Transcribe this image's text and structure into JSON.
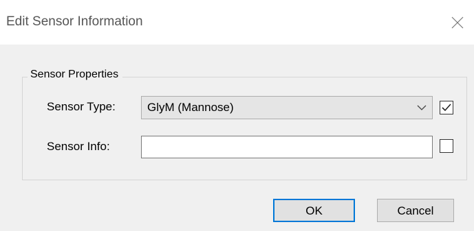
{
  "window": {
    "title": "Edit Sensor Information",
    "close_icon": "close-icon"
  },
  "group": {
    "legend": "Sensor Properties"
  },
  "sensor_type": {
    "label": "Sensor Type:",
    "selected_value": "GlyM (Mannose)",
    "checkbox_checked": true
  },
  "sensor_info": {
    "label": "Sensor Info:",
    "value": "",
    "checkbox_checked": false
  },
  "buttons": {
    "ok_label": "OK",
    "cancel_label": "Cancel"
  },
  "colors": {
    "dialog_background": "#f0f0f0",
    "default_button_border": "#0078d7"
  }
}
